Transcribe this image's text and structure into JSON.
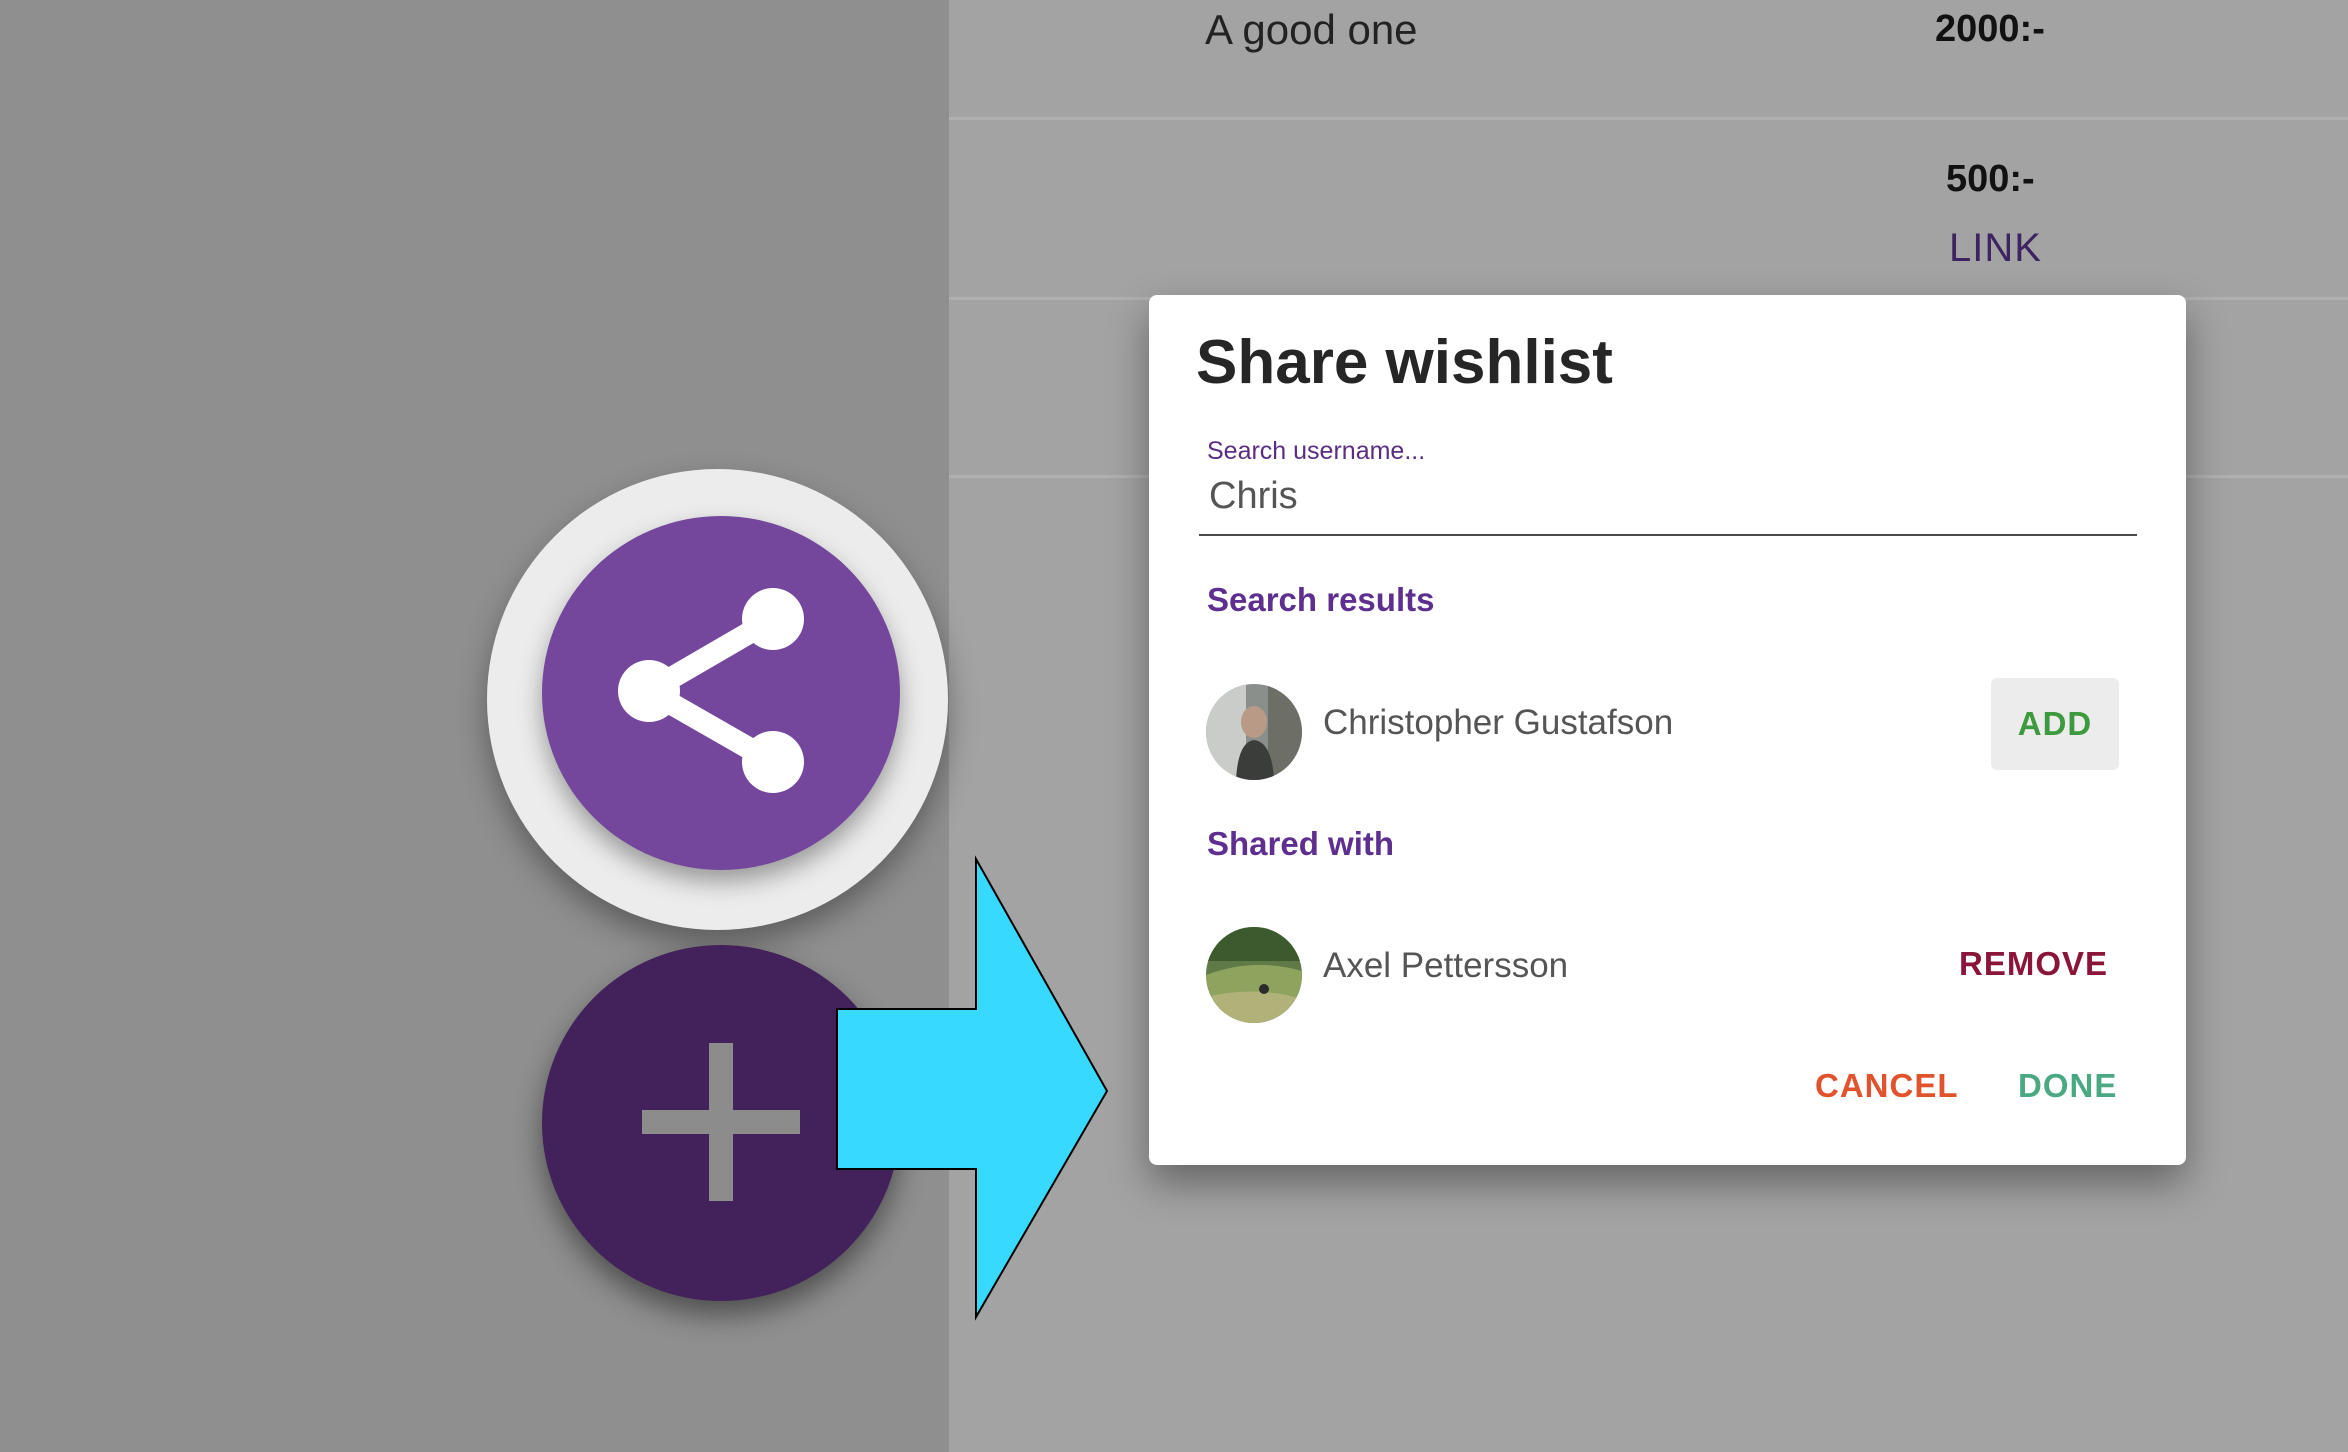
{
  "background_list": {
    "items": [
      {
        "title": "A good one",
        "price": "2000:-"
      },
      {
        "title": "",
        "price": "500:-",
        "link_label": "LINK"
      }
    ]
  },
  "fabs": {
    "share_icon": "share-icon",
    "add_icon": "plus-icon"
  },
  "annotation": {
    "arrow_color": "#38d9ff"
  },
  "dialog": {
    "title": "Share wishlist",
    "search": {
      "placeholder": "Search username...",
      "value": "Chris"
    },
    "search_results_heading": "Search results",
    "search_results": [
      {
        "name": "Christopher Gustafson",
        "action_label": "ADD"
      }
    ],
    "shared_with_heading": "Shared with",
    "shared_with": [
      {
        "name": "Axel Pettersson",
        "action_label": "REMOVE"
      }
    ],
    "cancel_label": "CANCEL",
    "done_label": "DONE"
  },
  "colors": {
    "primary": "#74479c",
    "primary_dark": "#43215b",
    "add": "#3e9a3e",
    "remove": "#8a1538",
    "cancel": "#e0532d",
    "done": "#4aa882"
  }
}
